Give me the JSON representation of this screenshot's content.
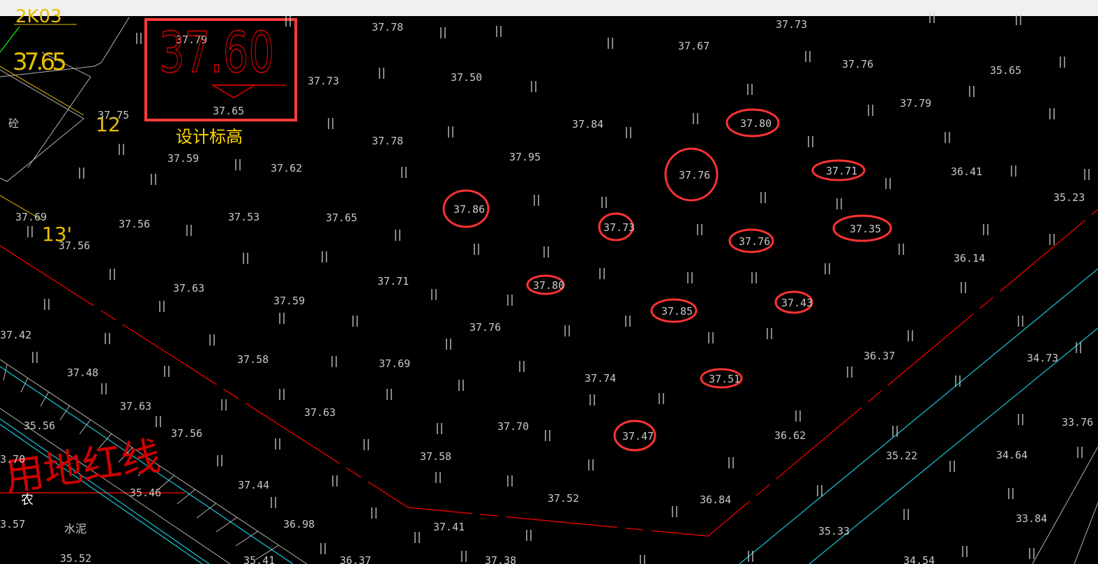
{
  "colors": {
    "background": "#000000",
    "elevation_text": "#c8c8c8",
    "ticks": "#d0d0d0",
    "property_line": "#e00000",
    "highlight_circle": "#ff3333",
    "road_cyan": "#16c8d8",
    "contour_gray": "#b4b4b4",
    "yellow": "#e8c000",
    "green": "#00ff00",
    "legend_box": "#ff3b3b",
    "legend_text_yellow": "#ffd700"
  },
  "legend": {
    "big_value": "37.60",
    "small_value": "37.65",
    "inner_value": "37.79",
    "caption": "设计标高"
  },
  "labels": {
    "property_line": "用地红线",
    "cement": "水泥",
    "agri": "农",
    "concrete": "砼",
    "building_num": "37.65",
    "num_12": "12",
    "num_13": "13'",
    "top_partial": "2K03"
  },
  "elevations": [
    "37.78",
    "37.73",
    "37.67",
    "37.76",
    "35.65",
    "37.79",
    "37.73",
    "37.50",
    "37.75",
    "37.84",
    "37.78",
    "37.59",
    "37.62",
    "37.95",
    "36.41",
    "35.23",
    "37.69",
    "37.56",
    "37.53",
    "37.65",
    "37.56",
    "36.14",
    "37.63",
    "37.71",
    "37.59",
    "37.42",
    "37.76",
    "37.48",
    "37.58",
    "37.69",
    "36.37",
    "34.73",
    "37.74",
    "37.63",
    "37.63",
    "37.56",
    "37.70",
    "36.62",
    "33.76",
    "35.56",
    "37.58",
    "35.22",
    "34.64",
    "37.44",
    "35.46",
    "37.52",
    "36.84",
    "33.84",
    "36.98",
    "37.41",
    "35.33",
    "35.52",
    "3.70",
    "3.57",
    "35.41",
    "36.37",
    "37.38",
    "34.54"
  ],
  "highlighted": [
    "37.80",
    "37.76",
    "37.71",
    "37.86",
    "37.73",
    "37.76",
    "37.35",
    "37.80",
    "37.85",
    "37.43",
    "37.51",
    "37.47"
  ]
}
